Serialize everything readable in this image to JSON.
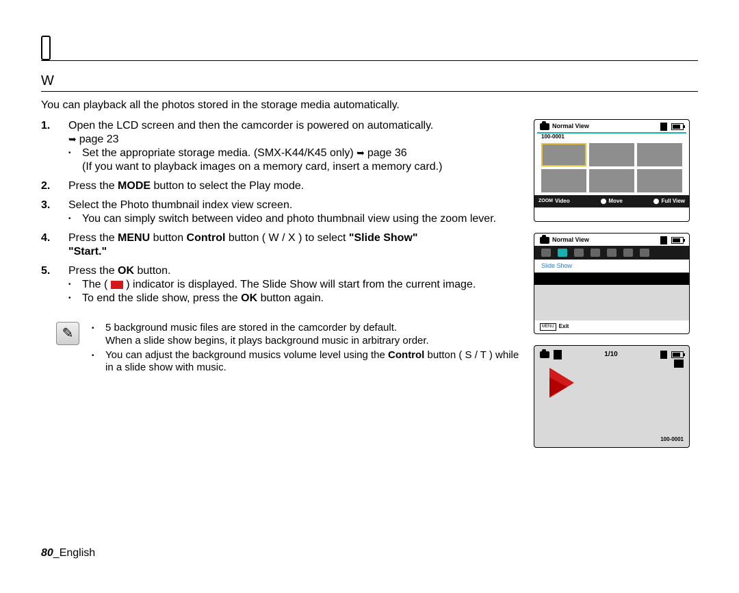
{
  "section_marker": "W",
  "intro": "You can playback all the photos stored in the storage media automatically.",
  "steps": [
    {
      "num": "1.",
      "text": "Open the LCD screen and then the camcorder is powered on automatically.",
      "ref1": "page 23",
      "bullet1a": "Set the appropriate storage media. (SMX-K44/K45 only)",
      "bullet1b": "page 36",
      "bullet1c": "(If you want to playback images on a memory card, insert a memory card.)"
    },
    {
      "num": "2.",
      "pre": "Press the",
      "bold": "MODE",
      "post": " button to select the Play mode."
    },
    {
      "num": "3.",
      "text": "Select the Photo thumbnail index view screen.",
      "sub": "You can simply switch between video and photo thumbnail view using the zoom lever."
    },
    {
      "num": "4.",
      "pre": "Press the",
      "b1": "MENU",
      "mid1": " button    ",
      "b2": "Control",
      "mid2": " button ( W / X ) to select ",
      "b3": "\"Slide Show\"",
      "mid3": " ",
      "b4": "\"Start.\""
    },
    {
      "num": "5.",
      "pre": "Press the",
      "b1": "OK",
      "post": " button.",
      "sub1a": "The (",
      "sub1b": ") indicator is displayed. The Slide Show will start from the current image.",
      "sub2a": "To end the slide show, press the ",
      "sub2b": "OK",
      "sub2c": " button again."
    }
  ],
  "notes": {
    "n1": "5 background music files are stored in the camcorder by default.",
    "n1b": "When a slide show begins, it plays background music in arbitrary order.",
    "n2a": "You can adjust the background musics volume level using the ",
    "n2b": "Control",
    "n2c": " button ( S / T ) while in a slide show with music."
  },
  "footer": {
    "page": "80",
    "sep": "_",
    "lang": "English"
  },
  "screens": {
    "a": {
      "title": "Normal View",
      "folder": "100-0001",
      "zoom": "ZOOM",
      "video": "Video",
      "move": "Move",
      "full": "Full View"
    },
    "b": {
      "title": "Normal View",
      "slide": "Slide Show",
      "menu": "MENU",
      "exit": "Exit"
    },
    "c": {
      "count": "1/10",
      "folder": "100-0001"
    }
  }
}
